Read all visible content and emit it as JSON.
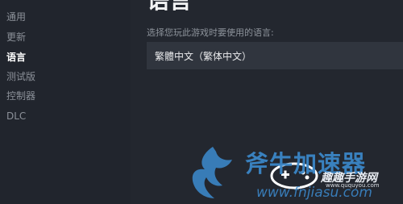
{
  "sidebar": {
    "items": [
      {
        "label": "通用",
        "selected": false
      },
      {
        "label": "更新",
        "selected": false
      },
      {
        "label": "语言",
        "selected": true
      },
      {
        "label": "测试版",
        "selected": false
      },
      {
        "label": "控制器",
        "selected": false
      },
      {
        "label": "DLC",
        "selected": false
      }
    ]
  },
  "main": {
    "title": "语言",
    "section_label": "选择您玩此游戏时要使用的语言:",
    "language_select": {
      "value": "繁體中文（繁体中文）"
    }
  },
  "watermark": {
    "brand": "斧牛加速器",
    "game_site": "趣趣手游网",
    "game_site_small": "www.ququyou.com",
    "url": "www.fnjiasu.com"
  },
  "colors": {
    "sidebar_bg": "#21252d",
    "main_bg": "#23272f",
    "select_bg": "#30353e",
    "watermark_blue": "#3b86c7"
  }
}
